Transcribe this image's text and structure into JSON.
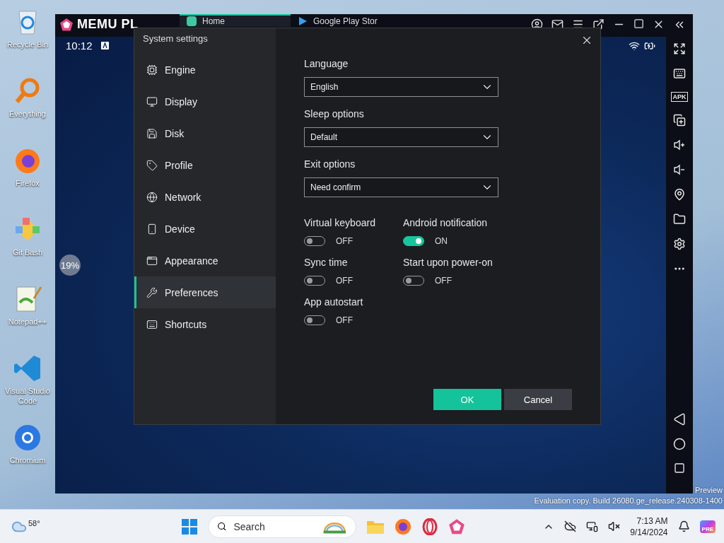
{
  "desktop": {
    "icons": [
      {
        "label": "Recycle Bin"
      },
      {
        "label": "Everything"
      },
      {
        "label": "Firefox"
      },
      {
        "label": "Git Bash"
      },
      {
        "label": "Notepad++"
      },
      {
        "label": "Visual Studio Code"
      },
      {
        "label": "Chromium"
      }
    ],
    "watermark": [
      "Preview",
      "Evaluation copy. Build 26080.ge_release.240308-1400"
    ]
  },
  "emulator": {
    "logo": "MEMU PL",
    "tabs": [
      {
        "label": "Home",
        "selected": true
      },
      {
        "label": "Google Play Stor",
        "selected": false
      }
    ],
    "time": "10:12",
    "loading": "19%",
    "apk_label": "APK"
  },
  "dialog": {
    "title": "System settings",
    "nav": [
      {
        "label": "Engine",
        "selected": false
      },
      {
        "label": "Display",
        "selected": false
      },
      {
        "label": "Disk",
        "selected": false
      },
      {
        "label": "Profile",
        "selected": false
      },
      {
        "label": "Network",
        "selected": false
      },
      {
        "label": "Device",
        "selected": false
      },
      {
        "label": "Appearance",
        "selected": false
      },
      {
        "label": "Preferences",
        "selected": true
      },
      {
        "label": "Shortcuts",
        "selected": false
      }
    ],
    "dropdowns": [
      {
        "label": "Language",
        "value": "English"
      },
      {
        "label": "Sleep options",
        "value": "Default"
      },
      {
        "label": "Exit options",
        "value": "Need confirm"
      }
    ],
    "toggles": [
      {
        "label": "Virtual keyboard",
        "on": false,
        "state": "OFF"
      },
      {
        "label": "Android notification",
        "on": true,
        "state": "ON"
      },
      {
        "label": "Sync time",
        "on": false,
        "state": "OFF"
      },
      {
        "label": "Start upon power-on",
        "on": false,
        "state": "OFF"
      },
      {
        "label": "App autostart",
        "on": false,
        "state": "OFF"
      }
    ],
    "buttons": [
      {
        "label": "OK",
        "kind": "primary"
      },
      {
        "label": "Cancel",
        "kind": "secondary"
      }
    ]
  },
  "taskbar": {
    "weather": "58°",
    "search": {
      "placeholder": "Search"
    },
    "time": "7:13 AM",
    "date": "9/14/2024",
    "badge": "PRE"
  }
}
